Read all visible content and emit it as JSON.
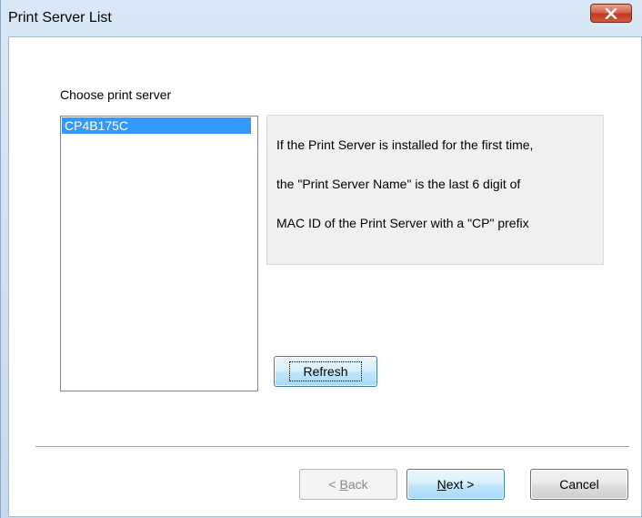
{
  "window": {
    "title": "Print Server List"
  },
  "icons": {
    "close": "close-icon"
  },
  "dialog": {
    "choose_label": "Choose print server",
    "servers": [
      "CP4B175C"
    ],
    "selected_server": "CP4B175C",
    "info_lines": [
      "If the Print Server is installed for the first time,",
      "the \"Print Server Name\" is the last 6 digit of",
      "MAC ID of the Print Server with a \"CP\" prefix"
    ],
    "refresh_label": "Refresh"
  },
  "buttons": {
    "back": {
      "before": "< ",
      "accel": "B",
      "after": "ack"
    },
    "next": {
      "before": "",
      "accel": "N",
      "after": "ext >"
    },
    "cancel_label": "Cancel"
  },
  "colors": {
    "selection": "#3399ff",
    "close_button": "#c1391e"
  }
}
